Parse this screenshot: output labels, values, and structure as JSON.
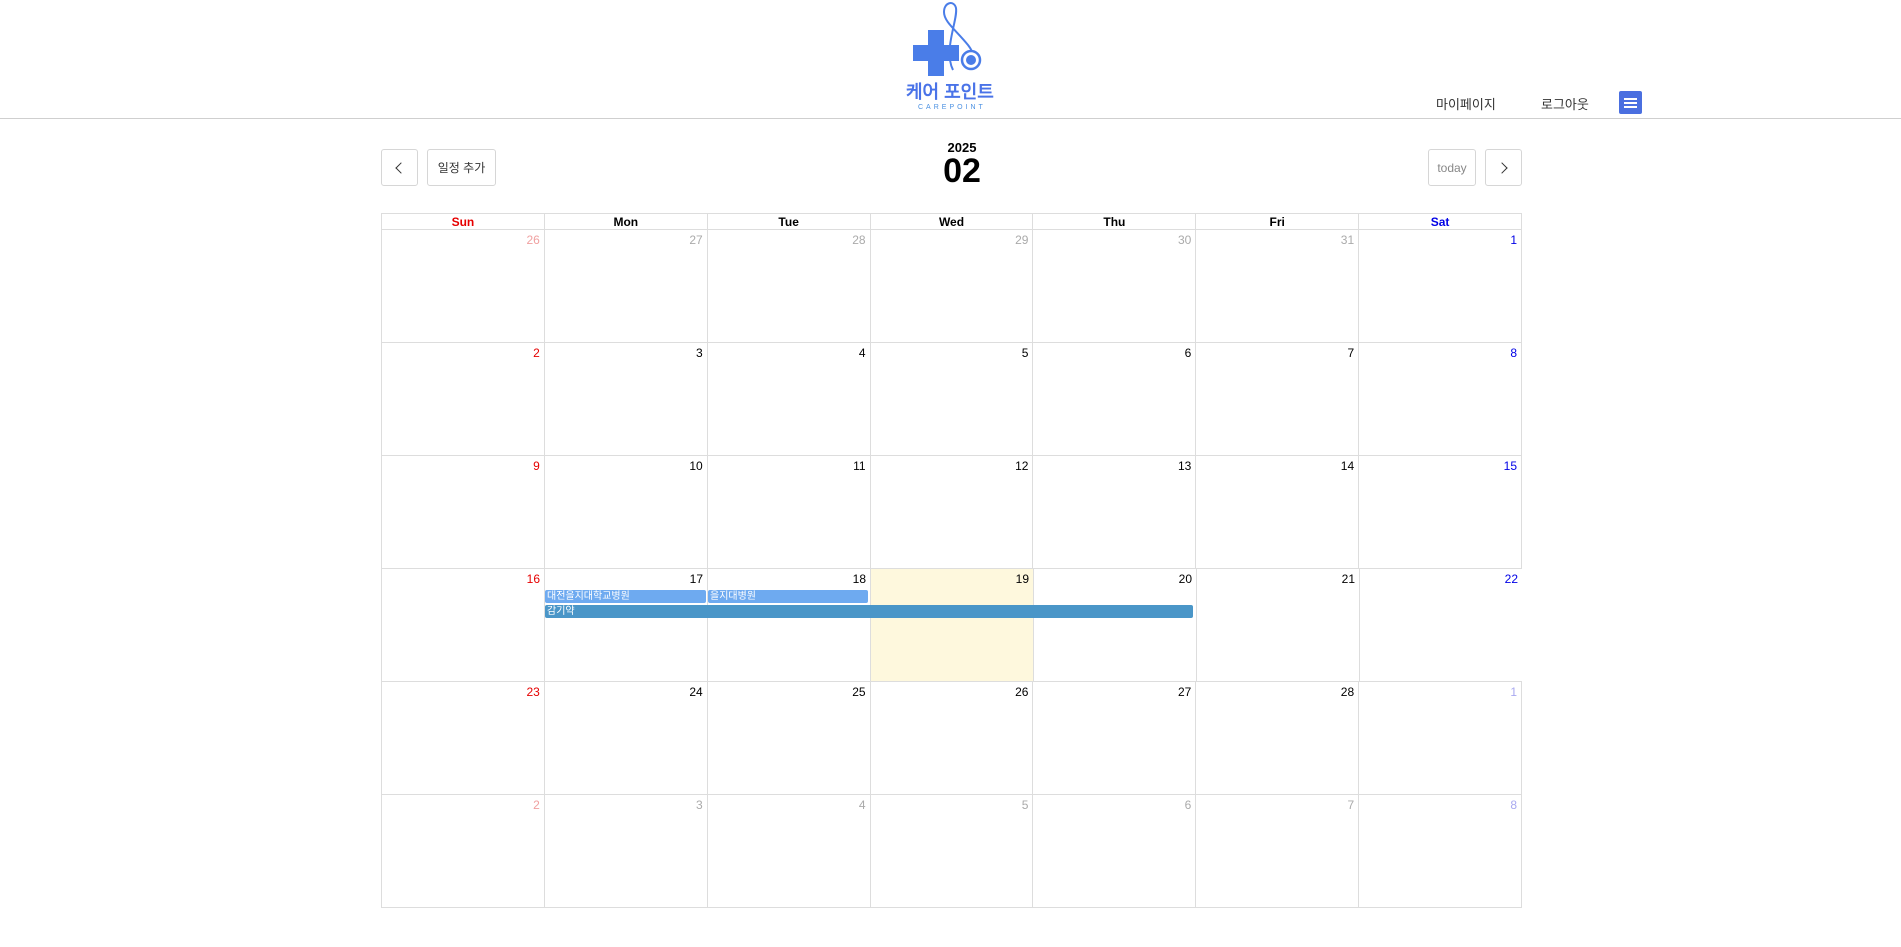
{
  "header": {
    "logo_ko": "케어 포인트",
    "logo_en": "CAREPOINT",
    "mypage": "마이페이지",
    "logout": "로그아웃",
    "menu_icon": "hamburger-icon"
  },
  "toolbar": {
    "prev_icon": "chevron-left-icon",
    "add_label": "일정 추가",
    "year": "2025",
    "month": "02",
    "today_label": "today",
    "next_icon": "chevron-right-icon"
  },
  "calendar": {
    "weekdays": [
      "Sun",
      "Mon",
      "Tue",
      "Wed",
      "Thu",
      "Fri",
      "Sat"
    ],
    "weeks": [
      [
        {
          "d": "26",
          "o": true
        },
        {
          "d": "27",
          "o": true
        },
        {
          "d": "28",
          "o": true
        },
        {
          "d": "29",
          "o": true
        },
        {
          "d": "30",
          "o": true
        },
        {
          "d": "31",
          "o": true
        },
        {
          "d": "1",
          "o": false
        }
      ],
      [
        {
          "d": "2",
          "o": false
        },
        {
          "d": "3",
          "o": false
        },
        {
          "d": "4",
          "o": false
        },
        {
          "d": "5",
          "o": false
        },
        {
          "d": "6",
          "o": false
        },
        {
          "d": "7",
          "o": false
        },
        {
          "d": "8",
          "o": false
        }
      ],
      [
        {
          "d": "9",
          "o": false
        },
        {
          "d": "10",
          "o": false
        },
        {
          "d": "11",
          "o": false
        },
        {
          "d": "12",
          "o": false
        },
        {
          "d": "13",
          "o": false
        },
        {
          "d": "14",
          "o": false
        },
        {
          "d": "15",
          "o": false
        }
      ],
      [
        {
          "d": "16",
          "o": false
        },
        {
          "d": "17",
          "o": false
        },
        {
          "d": "18",
          "o": false
        },
        {
          "d": "19",
          "o": false,
          "today": true
        },
        {
          "d": "20",
          "o": false
        },
        {
          "d": "21",
          "o": false
        },
        {
          "d": "22",
          "o": false
        }
      ],
      [
        {
          "d": "23",
          "o": false
        },
        {
          "d": "24",
          "o": false
        },
        {
          "d": "25",
          "o": false
        },
        {
          "d": "26",
          "o": false
        },
        {
          "d": "27",
          "o": false
        },
        {
          "d": "28",
          "o": false
        },
        {
          "d": "1",
          "o": true
        }
      ],
      [
        {
          "d": "2",
          "o": true
        },
        {
          "d": "3",
          "o": true
        },
        {
          "d": "4",
          "o": true
        },
        {
          "d": "5",
          "o": true
        },
        {
          "d": "6",
          "o": true
        },
        {
          "d": "7",
          "o": true
        },
        {
          "d": "8",
          "o": true
        }
      ]
    ],
    "events": [
      {
        "title": "대전을지대학교병원",
        "start": "17",
        "end": "17"
      },
      {
        "title": "을지대병원",
        "start": "18",
        "end": "18"
      },
      {
        "title": "감기약",
        "start": "17",
        "end": "20"
      }
    ],
    "colors": {
      "sunday": "#e60000",
      "saturday": "#0000e6",
      "today_bg": "#fef8dd",
      "event_light": "#6eaaf0",
      "event_dark": "#4a96c8"
    }
  }
}
